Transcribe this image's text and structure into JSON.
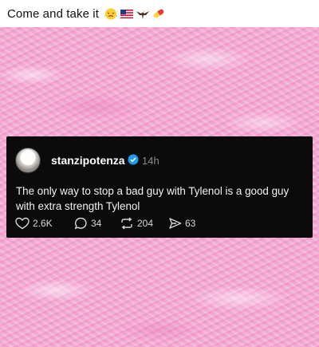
{
  "caption": {
    "text": "Come and take it",
    "emoji_icons": [
      "steaming-face-icon",
      "us-flag-icon",
      "eagle-icon",
      "pill-icon"
    ]
  },
  "post": {
    "username": "stanzipotenza",
    "verified": true,
    "timestamp": "14h",
    "text": "The only way to stop a bad guy with Tylenol is a good guy with extra strength Tylenol",
    "actions": {
      "likes": "2.6K",
      "comments": "34",
      "reposts": "204",
      "shares": "63"
    }
  },
  "colors": {
    "background_fur": "#f3a6d2",
    "card": "#0b0b0b",
    "verified_badge": "#1d9bf0"
  }
}
